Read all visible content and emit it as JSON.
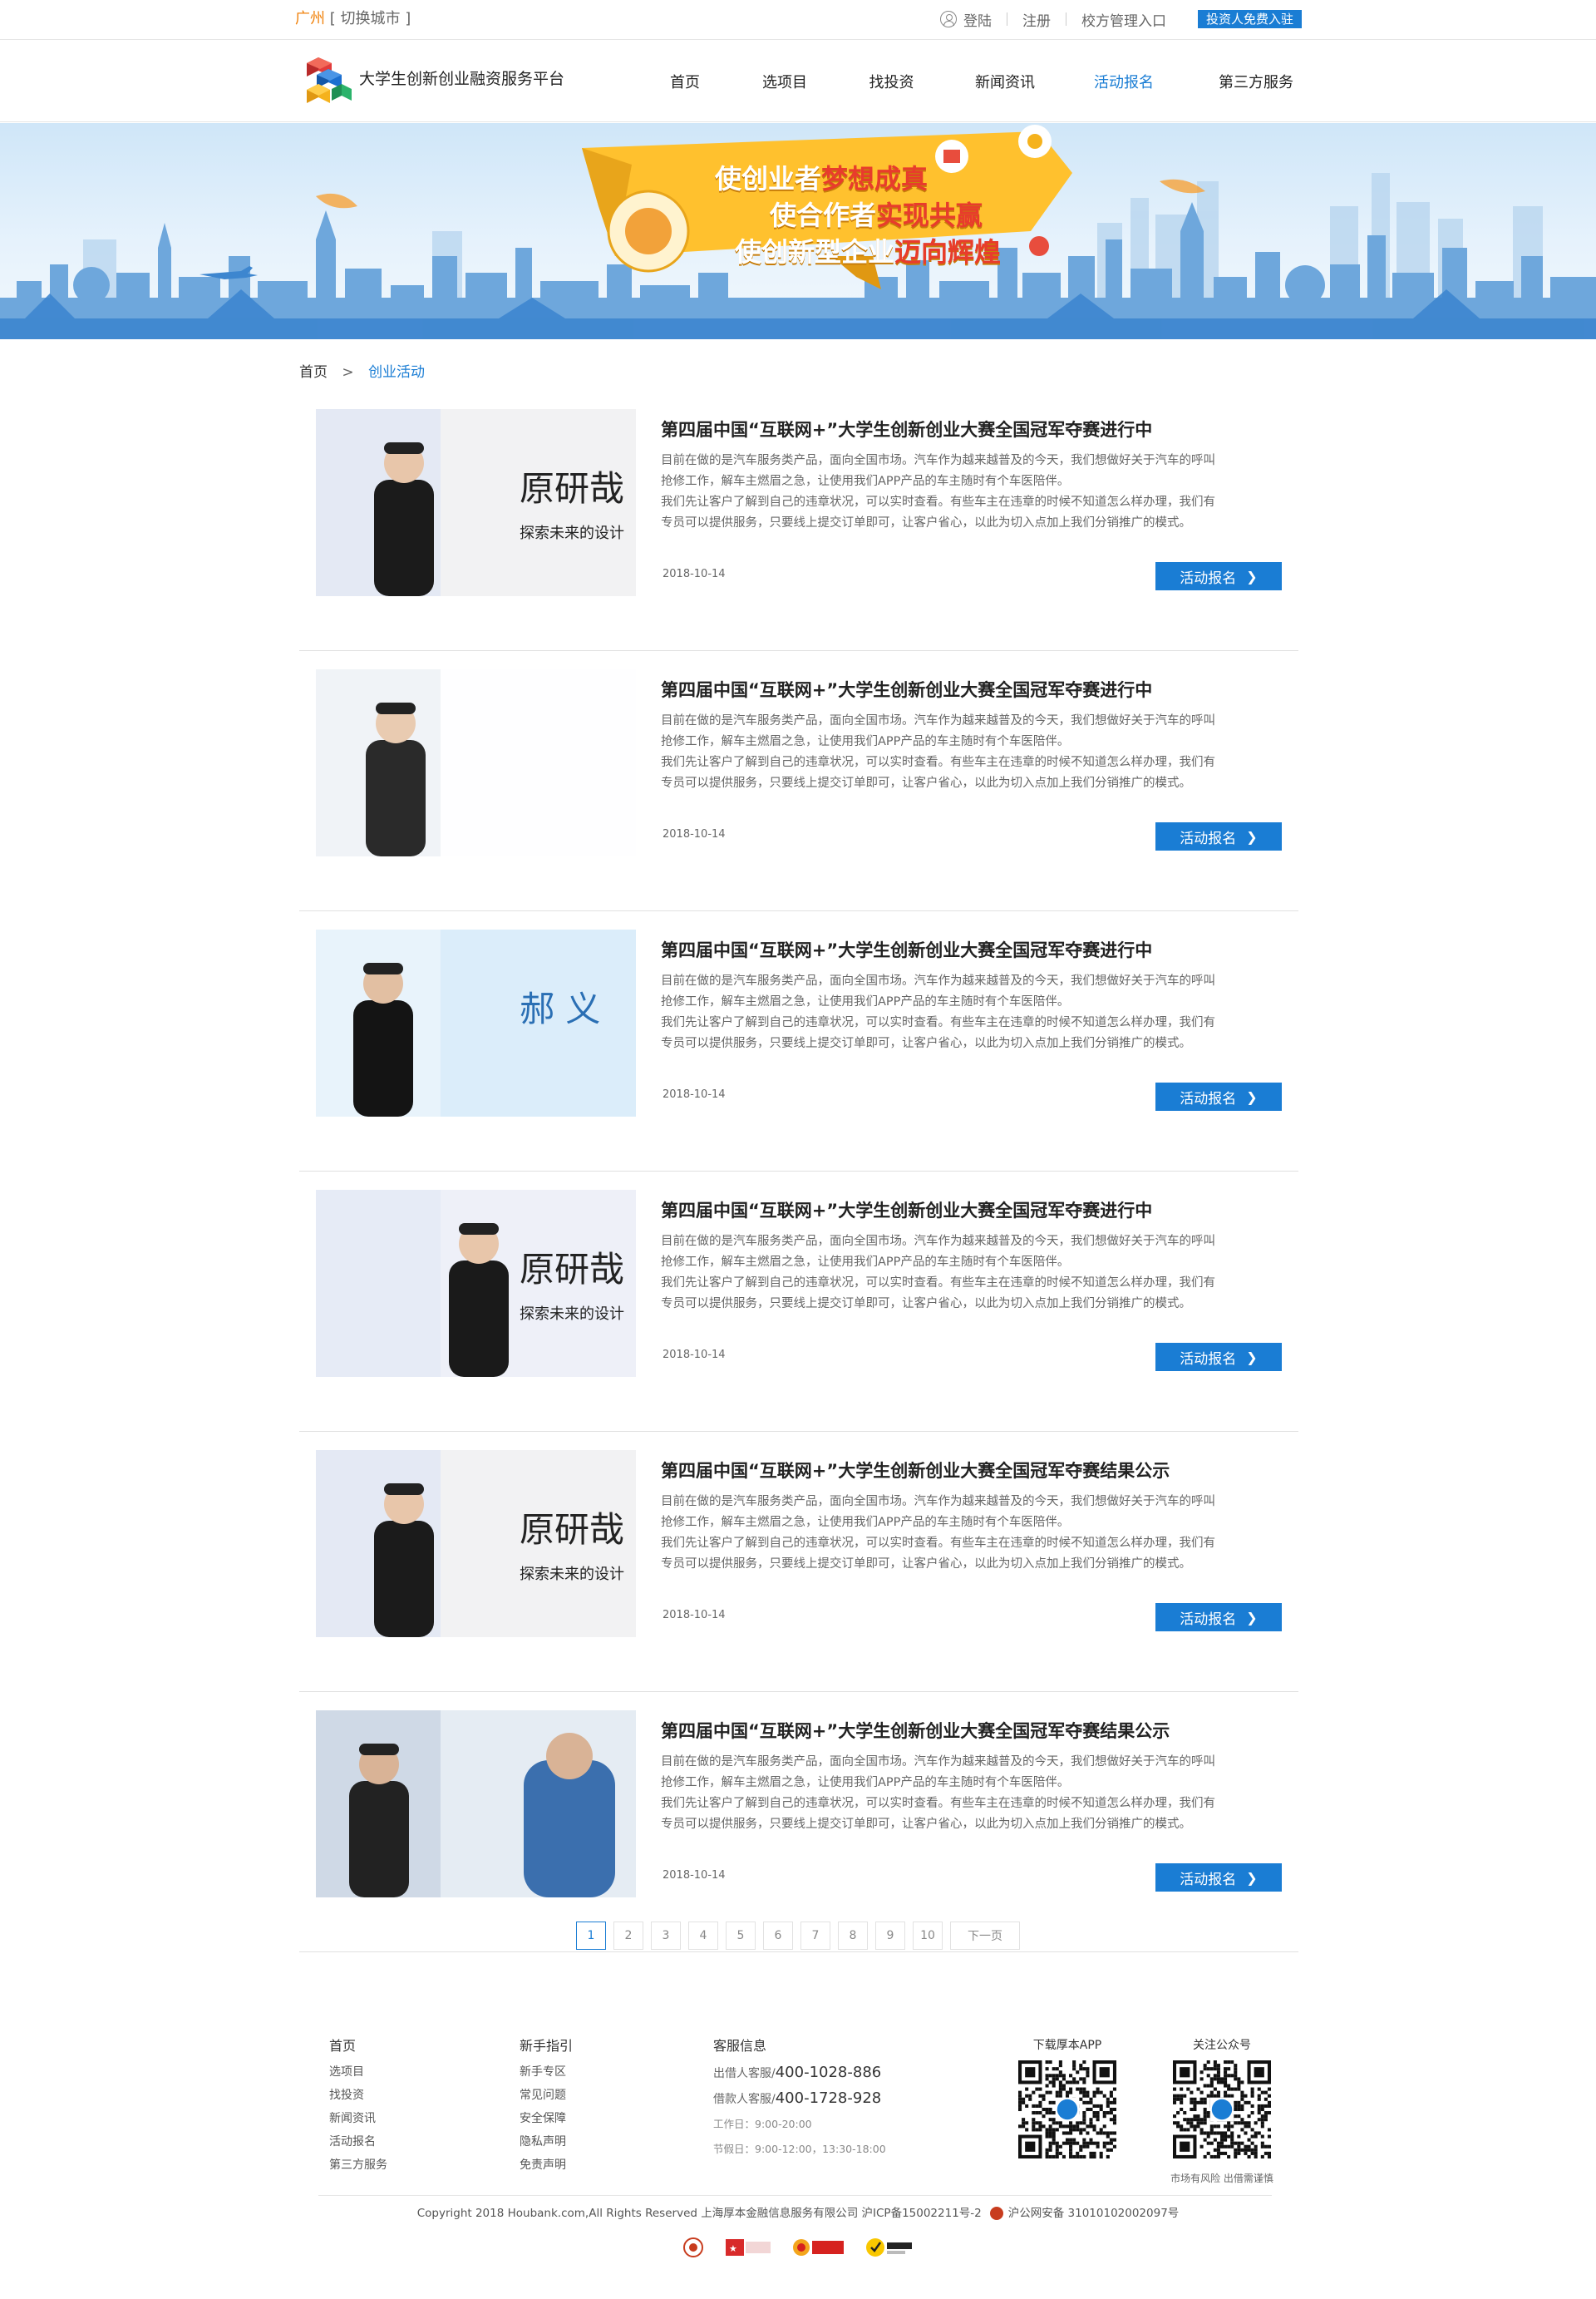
{
  "topbar": {
    "city": "广州",
    "switch_city": "[ 切换城市 ]",
    "login": "登陆",
    "register": "注册",
    "school_entry": "校方管理入口",
    "investor_btn": "投资人免费入驻"
  },
  "nav": {
    "site_name": "大学生创新创业融资服务平台",
    "items": [
      {
        "label": "首页"
      },
      {
        "label": "选项目"
      },
      {
        "label": "找投资"
      },
      {
        "label": "新闻资讯"
      },
      {
        "label": "活动报名"
      },
      {
        "label": "第三方服务"
      }
    ],
    "active_index": 4
  },
  "banner": {
    "line1a": "使创业者",
    "line1b": "梦想成真",
    "line2a": "使合作者",
    "line2b": "实现共赢",
    "line3a": "使创新型企业",
    "line3b": "迈向辉煌"
  },
  "breadcrumb": {
    "home": "首页",
    "separator": ">",
    "current": "创业活动"
  },
  "list": [
    {
      "title": "第四届中国“互联网+”大学生创新创业大赛全国冠军夺赛进行中",
      "desc": [
        "目前在做的是汽车服务类产品，面向全国市场。汽车作为越来越普及的今天，我们想做好关于汽车的呼叫",
        "抢修工作，解车主燃眉之急，让使用我们APP产品的车主随时有个车医陪伴。",
        "我们先让客户了解到自己的违章状况，可以实时查看。有些车主在违章的时候不知道怎么样办理，我们有",
        "专员可以提供服务，只要线上提交订单即可，让客户省心，以此为切入点加上我们分销推广的模式。"
      ],
      "date": "2018-10-14",
      "button": "活动报名"
    },
    {
      "title": "第四届中国“互联网+”大学生创新创业大赛全国冠军夺赛进行中",
      "desc": [
        "目前在做的是汽车服务类产品，面向全国市场。汽车作为越来越普及的今天，我们想做好关于汽车的呼叫",
        "抢修工作，解车主燃眉之急，让使用我们APP产品的车主随时有个车医陪伴。",
        "我们先让客户了解到自己的违章状况，可以实时查看。有些车主在违章的时候不知道怎么样办理，我们有",
        "专员可以提供服务，只要线上提交订单即可，让客户省心，以此为切入点加上我们分销推广的模式。"
      ],
      "date": "2018-10-14",
      "button": "活动报名"
    },
    {
      "title": "第四届中国“互联网+”大学生创新创业大赛全国冠军夺赛进行中",
      "desc": [
        "目前在做的是汽车服务类产品，面向全国市场。汽车作为越来越普及的今天，我们想做好关于汽车的呼叫",
        "抢修工作，解车主燃眉之急，让使用我们APP产品的车主随时有个车医陪伴。",
        "我们先让客户了解到自己的违章状况，可以实时查看。有些车主在违章的时候不知道怎么样办理，我们有",
        "专员可以提供服务，只要线上提交订单即可，让客户省心，以此为切入点加上我们分销推广的模式。"
      ],
      "date": "2018-10-14",
      "button": "活动报名"
    },
    {
      "title": "第四届中国“互联网+”大学生创新创业大赛全国冠军夺赛进行中",
      "desc": [
        "目前在做的是汽车服务类产品，面向全国市场。汽车作为越来越普及的今天，我们想做好关于汽车的呼叫",
        "抢修工作，解车主燃眉之急，让使用我们APP产品的车主随时有个车医陪伴。",
        "我们先让客户了解到自己的违章状况，可以实时查看。有些车主在违章的时候不知道怎么样办理，我们有",
        "专员可以提供服务，只要线上提交订单即可，让客户省心，以此为切入点加上我们分销推广的模式。"
      ],
      "date": "2018-10-14",
      "button": "活动报名"
    },
    {
      "title": "第四届中国“互联网+”大学生创新创业大赛全国冠军夺赛结果公示",
      "desc": [
        "目前在做的是汽车服务类产品，面向全国市场。汽车作为越来越普及的今天，我们想做好关于汽车的呼叫",
        "抢修工作，解车主燃眉之急，让使用我们APP产品的车主随时有个车医陪伴。",
        "我们先让客户了解到自己的违章状况，可以实时查看。有些车主在违章的时候不知道怎么样办理，我们有",
        "专员可以提供服务，只要线上提交订单即可，让客户省心，以此为切入点加上我们分销推广的模式。"
      ],
      "date": "2018-10-14",
      "button": "活动报名"
    },
    {
      "title": "第四届中国“互联网+”大学生创新创业大赛全国冠军夺赛结果公示",
      "desc": [
        "目前在做的是汽车服务类产品，面向全国市场。汽车作为越来越普及的今天，我们想做好关于汽车的呼叫",
        "抢修工作，解车主燃眉之急，让使用我们APP产品的车主随时有个车医陪伴。",
        "我们先让客户了解到自己的违章状况，可以实时查看。有些车主在违章的时候不知道怎么样办理，我们有",
        "专员可以提供服务，只要线上提交订单即可，让客户省心，以此为切入点加上我们分销推广的模式。"
      ],
      "date": "2018-10-14",
      "button": "活动报名"
    }
  ],
  "thumbs": [
    {
      "stage_text": "原研哉",
      "sub_text": "探索未来的设计"
    },
    {
      "stage_text": "",
      "sub_text": ""
    },
    {
      "stage_text": "郝 义",
      "sub_text": ""
    },
    {
      "stage_text": "原研哉",
      "sub_text": "探索未来的设计"
    },
    {
      "stage_text": "原研哉",
      "sub_text": "探索未来的设计"
    },
    {
      "stage_text": "",
      "sub_text": ""
    }
  ],
  "pagination": {
    "pages": [
      "1",
      "2",
      "3",
      "4",
      "5",
      "6",
      "7",
      "8",
      "9",
      "10"
    ],
    "current": "1",
    "next": "下一页"
  },
  "footer": {
    "col1": {
      "head": "首页",
      "links": [
        "选项目",
        "找投资",
        "新闻资讯",
        "活动报名",
        "第三方服务"
      ]
    },
    "col2": {
      "head": "新手指引",
      "links": [
        "新手专区",
        "常见问题",
        "安全保障",
        "隐私声明",
        "免责声明"
      ]
    },
    "service": {
      "head": "客服信息",
      "lender_label": "出借人客服/",
      "lender_phone": "400-1028-886",
      "borrower_label": "借款人客服/",
      "borrower_phone": "400-1728-928",
      "workday": "工作日：9:00-20:00",
      "holiday": "节假日：9:00-12:00，13:30-18:00"
    },
    "app": {
      "caption": "下载厚本APP"
    },
    "wechat": {
      "caption": "关注公众号",
      "note": "市场有风险 出借需谨慎"
    },
    "copyright": "Copyright 2018 Houbank.com,All Rights Reserved    上海厚本金融信息服务有限公司    沪ICP备15002211号-2",
    "police": "沪公网安备 31010102002097号",
    "trust_badges": [
      "police-badge",
      "credit-badge",
      "verified-badge",
      "norton-badge"
    ]
  },
  "colors": {
    "accent": "#1a7dd4",
    "city_orange": "#f0820c",
    "banner_yellow": "#ffc12e"
  }
}
